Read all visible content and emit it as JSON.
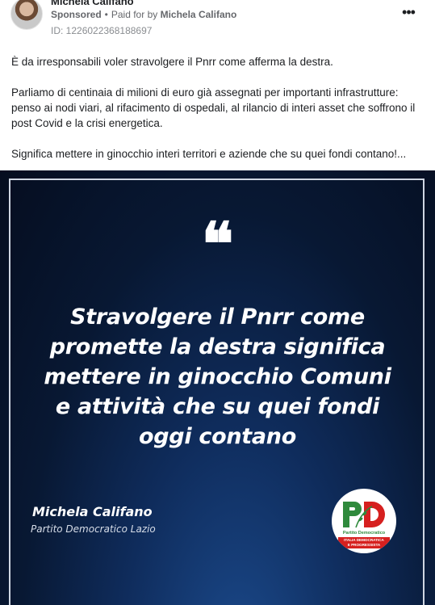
{
  "post": {
    "author": "Michela Califano",
    "sponsored": "Sponsored",
    "paid_for_prefix": "Paid for by",
    "payer": "Michela Califano",
    "ad_id": "ID: 1226022368188697",
    "more_icon": "ellipsis-icon",
    "body": [
      "È da irresponsabili voler stravolgere il Pnrr come afferma la destra.",
      "Parliamo di centinaia di milioni di euro già assegnati per importanti infrastrutture: penso ai nodi viari, al rifacimento di ospedali, al rilancio di interi asset che soffrono il post Covid e la crisi energetica.",
      "Significa mettere in ginocchio interi territori e aziende che su quei fondi contano!..."
    ]
  },
  "creative": {
    "quote_mark": "❝",
    "quote_lines": [
      "Stravolgere il Pnrr come",
      "promette la destra significa",
      "mettere in ginocchio Comuni",
      "e attività che su quei fondi",
      "oggi contano"
    ],
    "signature_name": "Michela Califano",
    "signature_party": "Partito Democratico Lazio",
    "logo": {
      "letters": "PD",
      "subtitle": "Partito Democratico",
      "band_line1": "ITALIA DEMOCRATICA",
      "band_line2": "E PROGRESSISTA"
    },
    "colors": {
      "background": "#081833",
      "accent_green": "#2f8a3c",
      "accent_red": "#d6201f"
    }
  }
}
